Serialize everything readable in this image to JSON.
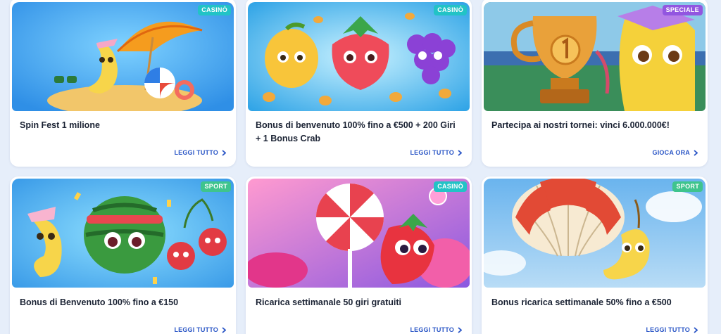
{
  "colors": {
    "background": "#e6eefa",
    "casino_badge": "#22c3c6",
    "sport_badge": "#3fc48d",
    "speciale_badge": "#9256e0",
    "cta": "#2a56c6"
  },
  "promos": [
    {
      "badge": "CASINÒ",
      "badge_type": "casino",
      "title": "Spin Fest 1 milione",
      "cta": "LEGGI TUTTO",
      "image": "banana-beach-umbrella"
    },
    {
      "badge": "CASINÒ",
      "badge_type": "casino",
      "title": "Bonus di benvenuto 100% fino a €500 + 200 Giri + 1 Bonus Crab",
      "cta": "LEGGI TUTTO",
      "image": "lemon-strawberry-grapes-coins"
    },
    {
      "badge": "SPECIALE",
      "badge_type": "speciale",
      "title": "Partecipa ai nostri tornei: vinci 6.000.000€!",
      "cta": "GIOCA ORA",
      "image": "trophy-banana"
    },
    {
      "badge": "SPORT",
      "badge_type": "sport",
      "title": "Bonus di Benvenuto 100% fino a €150",
      "cta": "LEGGI TUTTO",
      "image": "banana-watermelon-cherries"
    },
    {
      "badge": "CASINÒ",
      "badge_type": "casino",
      "title": "Ricarica settimanale 50 giri gratuiti",
      "cta": "LEGGI TUTTO",
      "image": "candy-strawberry"
    },
    {
      "badge": "SPORT",
      "badge_type": "sport",
      "title": "Bonus ricarica settimanale 50% fino a €500",
      "cta": "LEGGI TUTTO",
      "image": "banana-hot-air-balloon"
    }
  ]
}
